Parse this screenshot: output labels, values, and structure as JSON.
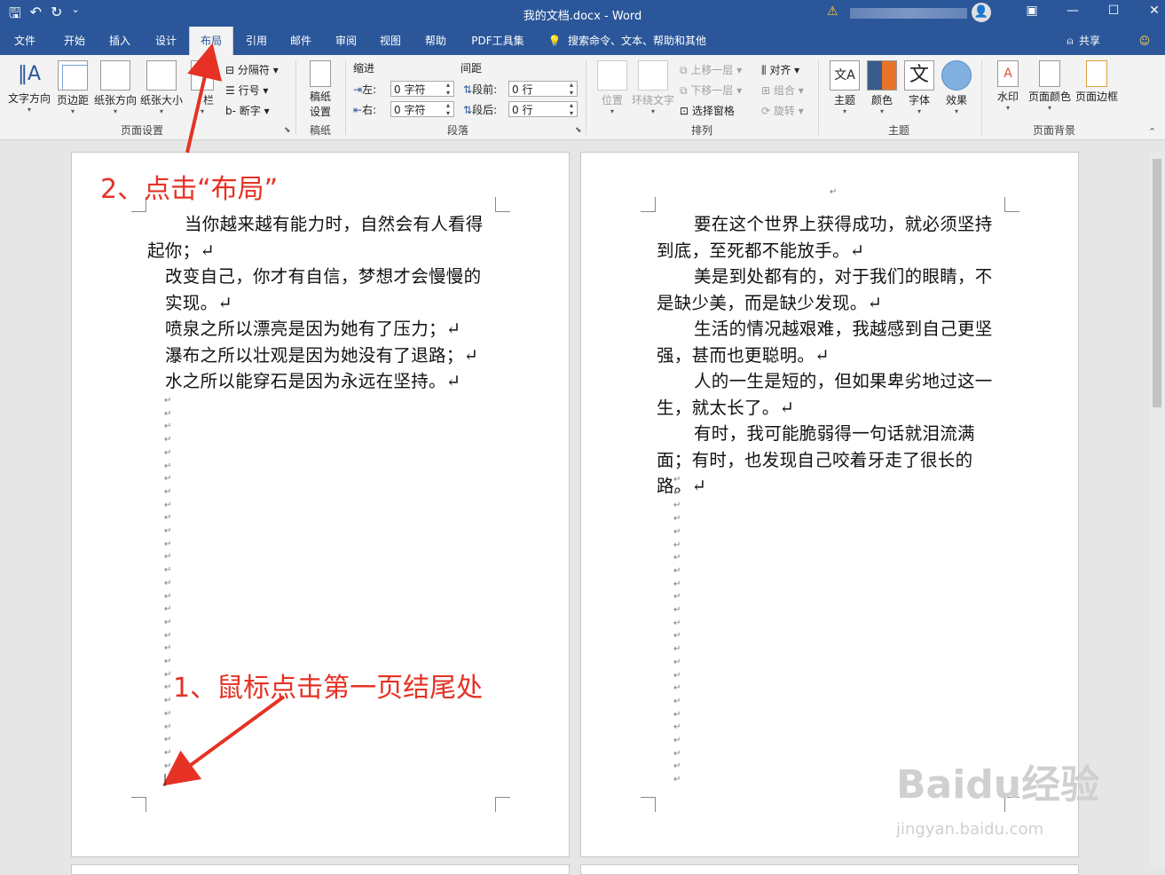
{
  "window": {
    "title": "我的文档.docx  -  Word",
    "qat": {
      "save": "🖫",
      "undo": "↶",
      "redo": "↻",
      "more": "⌄"
    },
    "controls": {
      "restore_ribbon": "▣",
      "minimize": "—",
      "maximize": "☐",
      "close": "✕"
    }
  },
  "tabs": [
    {
      "label": "文件"
    },
    {
      "label": "开始"
    },
    {
      "label": "插入"
    },
    {
      "label": "设计"
    },
    {
      "label": "布局"
    },
    {
      "label": "引用"
    },
    {
      "label": "邮件"
    },
    {
      "label": "审阅"
    },
    {
      "label": "视图"
    },
    {
      "label": "帮助"
    },
    {
      "label": "PDF工具集"
    }
  ],
  "search": {
    "label": "搜索命令、文本、帮助和其他"
  },
  "share": {
    "label": "共享"
  },
  "ribbon": {
    "page_setup": {
      "text_direction": "文字方向",
      "margins": "页边距",
      "orientation": "纸张方向",
      "size": "纸张大小",
      "columns": "栏",
      "breaks": "分隔符",
      "line_numbers": "行号",
      "hyphenation": "断字",
      "group": "页面设置"
    },
    "manuscript": {
      "line1": "稿纸",
      "line2": "设置",
      "group": "稿纸"
    },
    "paragraph": {
      "indent": "缩进",
      "spacing": "间距",
      "left": "左:",
      "right": "右:",
      "left_value": "0 字符",
      "right_value": "0 字符",
      "before": "段前:",
      "after": "段后:",
      "before_value": "0 行",
      "after_value": "0 行",
      "group": "段落"
    },
    "arrange": {
      "position": "位置",
      "wrap_text": "环绕文字",
      "bring_forward": "上移一层",
      "send_backward": "下移一层",
      "selection_pane": "选择窗格",
      "align": "对齐",
      "group_btn": "组合",
      "rotate": "旋转",
      "group": "排列"
    },
    "themes": {
      "theme": "主题",
      "colors": "颜色",
      "fonts": "字体",
      "effects": "效果",
      "group": "主题"
    },
    "page_background": {
      "watermark": "水印",
      "page_color": "页面颜色",
      "page_borders": "页面边框",
      "group": "页面背景"
    }
  },
  "document": {
    "page1": [
      "当你越来越有能力时，自然会有人看得起你；↵",
      "改变自己，你才有自信，梦想才会慢慢的实现。↵",
      "喷泉之所以漂亮是因为她有了压力；↵",
      "瀑布之所以壮观是因为她没有了退路；↵",
      "水之所以能穿石是因为永远在坚持。↵"
    ],
    "page2": [
      "要在这个世界上获得成功，就必须坚持到底，至死都不能放手。↵",
      "美是到处都有的，对于我们的眼睛，不是缺少美，而是缺少发现。↵",
      "生活的情况越艰难，我越感到自己更坚强，甚而也更聪明。↵",
      "人的一生是短的，但如果卑劣地过这一生，就太长了。↵",
      "有时，我可能脆弱得一句话就泪流满面；有时，也发现自己咬着牙走了很长的路。↵"
    ],
    "empty_mark": "↵",
    "top_mark": "↵"
  },
  "annotations": {
    "step1": "1、鼠标点击第一页结尾处",
    "step2": "2、点击“布局”"
  },
  "watermark": {
    "brand": "Baidu经验",
    "url": "jingyan.baidu.com"
  },
  "colors": {
    "accent": "#2b579a",
    "annotation": "#e53224"
  }
}
